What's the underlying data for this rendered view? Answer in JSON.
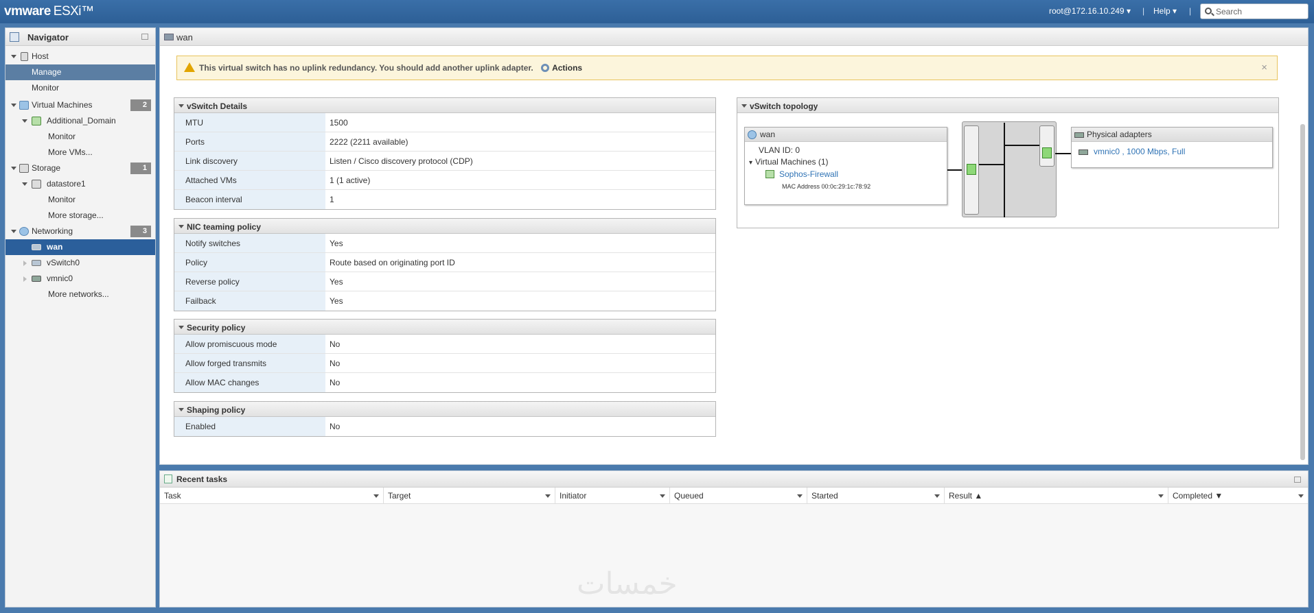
{
  "header": {
    "logo_brand": "vmware",
    "logo_product": "ESXi™",
    "user": "root@172.16.10.249",
    "help": "Help",
    "search_placeholder": "Search"
  },
  "navigator": {
    "title": "Navigator",
    "host": "Host",
    "manage": "Manage",
    "monitor": "Monitor",
    "vms": {
      "label": "Virtual Machines",
      "count": "2"
    },
    "vm_name": "Additional_Domain",
    "vm_monitor": "Monitor",
    "more_vms": "More VMs...",
    "storage": {
      "label": "Storage",
      "count": "1"
    },
    "datastore": "datastore1",
    "ds_monitor": "Monitor",
    "more_storage": "More storage...",
    "networking": {
      "label": "Networking",
      "count": "3"
    },
    "wan": "wan",
    "vswitch0": "vSwitch0",
    "vmnic0": "vmnic0",
    "more_networks": "More networks..."
  },
  "main": {
    "title": "wan",
    "warning": "This virtual switch has no uplink redundancy. You should add another uplink adapter.",
    "actions": "Actions",
    "close": "×"
  },
  "vswitch_details": {
    "title": "vSwitch Details",
    "rows": [
      {
        "label": "MTU",
        "value": "1500"
      },
      {
        "label": "Ports",
        "value": "2222 (2211 available)"
      },
      {
        "label": "Link discovery",
        "value": "Listen / Cisco discovery protocol (CDP)"
      },
      {
        "label": "Attached VMs",
        "value": "1 (1 active)"
      },
      {
        "label": "Beacon interval",
        "value": "1"
      }
    ]
  },
  "nic_teaming": {
    "title": "NIC teaming policy",
    "rows": [
      {
        "label": "Notify switches",
        "value": "Yes"
      },
      {
        "label": "Policy",
        "value": "Route based on originating port ID"
      },
      {
        "label": "Reverse policy",
        "value": "Yes"
      },
      {
        "label": "Failback",
        "value": "Yes"
      }
    ]
  },
  "security": {
    "title": "Security policy",
    "rows": [
      {
        "label": "Allow promiscuous mode",
        "value": "No"
      },
      {
        "label": "Allow forged transmits",
        "value": "No"
      },
      {
        "label": "Allow MAC changes",
        "value": "No"
      }
    ]
  },
  "shaping": {
    "title": "Shaping policy",
    "rows": [
      {
        "label": "Enabled",
        "value": "No"
      }
    ]
  },
  "topology": {
    "title": "vSwitch topology",
    "portgroup": "wan",
    "vlan": "VLAN ID: 0",
    "vms_label": "Virtual Machines (1)",
    "vm": "Sophos-Firewall",
    "mac": "MAC Address 00:0c:29:1c:78:92",
    "physical_title": "Physical adapters",
    "adapter": "vmnic0 , 1000 Mbps, Full"
  },
  "tasks": {
    "title": "Recent tasks",
    "columns": [
      "Task",
      "Target",
      "Initiator",
      "Queued",
      "Started",
      "Result ▲",
      "Completed ▼"
    ]
  },
  "watermark": "خمسات"
}
